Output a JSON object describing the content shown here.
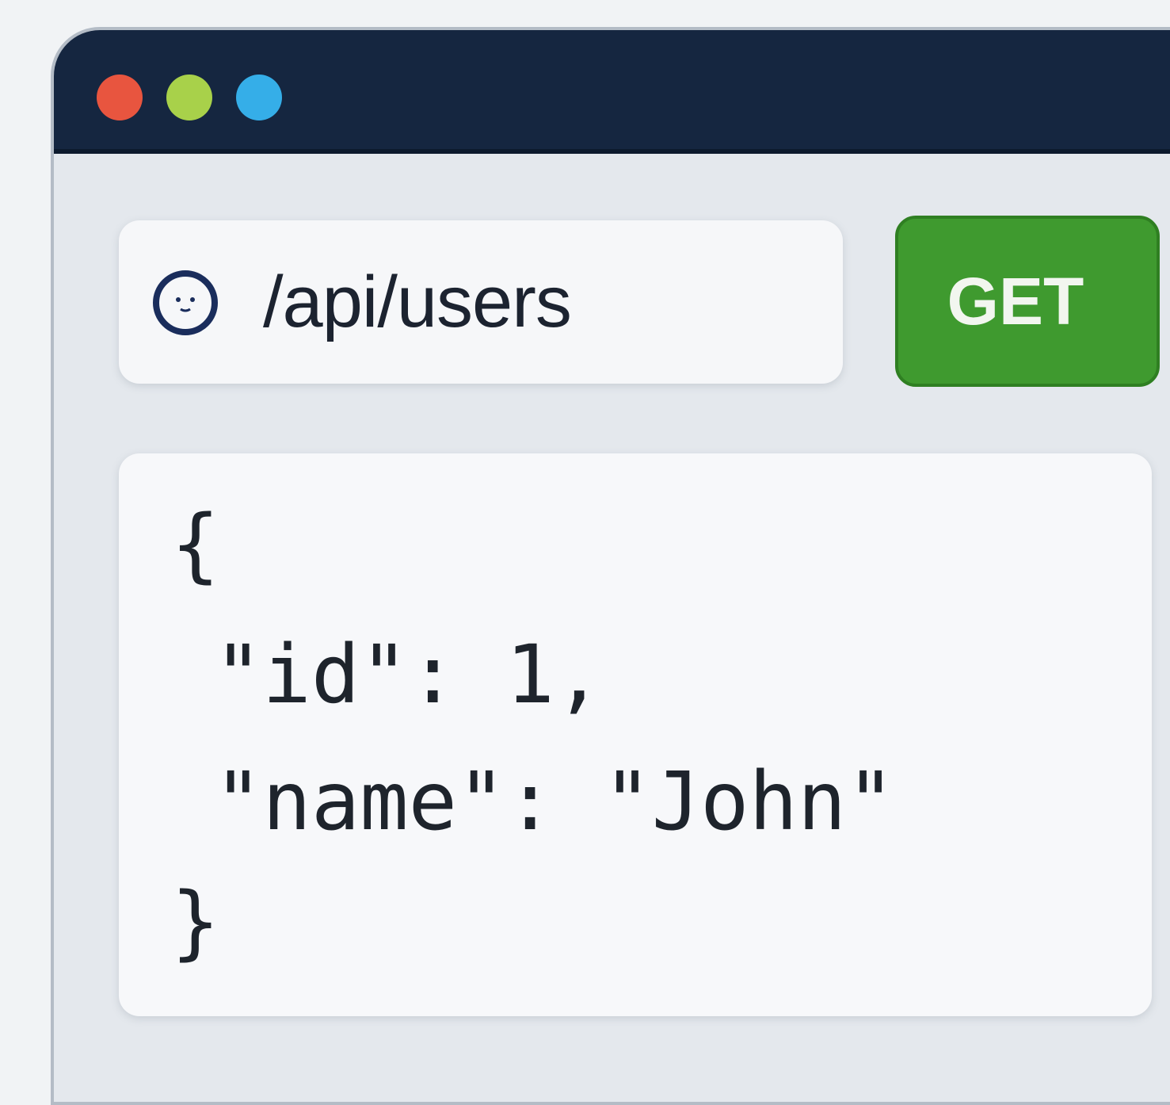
{
  "window": {
    "traffic_lights": [
      {
        "name": "close",
        "color": "#e8553f"
      },
      {
        "name": "minimize",
        "color": "#a8d14a"
      },
      {
        "name": "zoom",
        "color": "#35aee8"
      }
    ]
  },
  "request": {
    "url": "/api/users",
    "url_icon": "circle-face-icon",
    "method_button_label": "GET"
  },
  "response": {
    "lines": [
      "{",
      "\"id\": 1,",
      "\"name\": \"John\"",
      "}"
    ]
  }
}
